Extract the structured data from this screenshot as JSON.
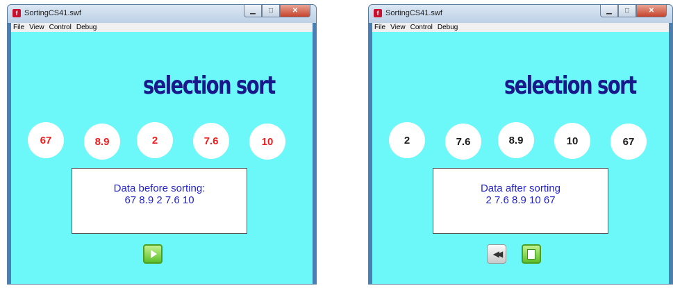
{
  "left_window": {
    "title": "SortingCS41.swf",
    "menu": [
      "File",
      "View",
      "Control",
      "Debug"
    ],
    "heading": "selection sort",
    "values": [
      "67",
      "8.9",
      "2",
      "7.6",
      "10"
    ],
    "info_line1": "Data before  sorting:",
    "info_line2": "67 8.9 2 7.6 10"
  },
  "right_window": {
    "title": "SortingCS41.swf",
    "menu": [
      "File",
      "View",
      "Control",
      "Debug"
    ],
    "heading": "selection sort",
    "values": [
      "2",
      "7.6",
      "8.9",
      "10",
      "67"
    ],
    "info_line1": "Data after sorting",
    "info_line2": "2 7.6 8.9 10 67"
  },
  "colors": {
    "stage": "#6cf8f9",
    "heading": "#181a8c",
    "unsorted_value": "#ee1c1c",
    "sorted_value": "#1a1a1a",
    "info_text": "#2323c8"
  },
  "icons": {
    "play": "play-icon",
    "rewind": "rewind-icon",
    "stop": "stop-icon"
  }
}
